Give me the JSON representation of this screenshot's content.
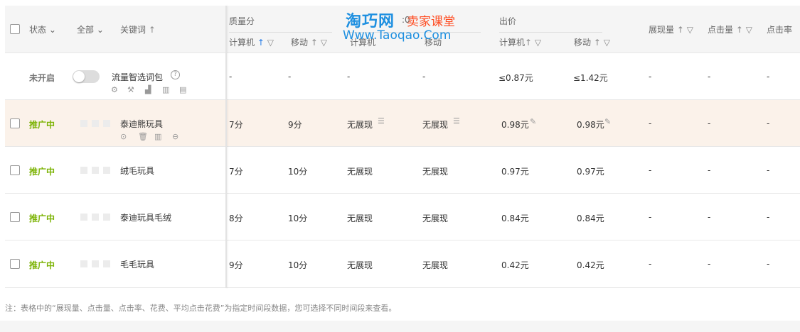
{
  "header": {
    "status": "状态",
    "all": "全部",
    "keyword": "关键词",
    "quality": "质量分",
    "quality_pc": "计算机",
    "quality_mobile": "移动",
    "mid_pc": "计算机",
    "mid_mobile": "移动",
    "mid_partial": ":0",
    "bid": "出价",
    "bid_pc": "计算机",
    "bid_mobile": "移动",
    "impressions": "展现量",
    "clicks": "点击量",
    "ctr": "点击率",
    "sort_up": "↑",
    "filter": "▽",
    "chev": "⌄"
  },
  "watermark": {
    "line1": "淘巧网",
    "line2": "卖家课堂",
    "line3": "Www.Taoqao.Com"
  },
  "smart_row": {
    "status": "未开启",
    "name": "流量智选词包",
    "help": "?",
    "q_pc": "-",
    "q_m": "-",
    "c3": "-",
    "c4": "-",
    "bid_pc": "≤0.87元",
    "bid_m": "≤1.42元",
    "imp": "-",
    "clk": "-",
    "ctr": "-"
  },
  "rows": [
    {
      "status": "推广中",
      "keyword": "泰迪熊玩具",
      "q_pc": "7分",
      "q_m": "9分",
      "c3": "无展现",
      "c4": "无展现",
      "bid_pc": "0.98元",
      "bid_m": "0.98元",
      "imp": "-",
      "clk": "-",
      "ctr": "-"
    },
    {
      "status": "推广中",
      "keyword": "绒毛玩具",
      "q_pc": "7分",
      "q_m": "10分",
      "c3": "无展现",
      "c4": "无展现",
      "bid_pc": "0.97元",
      "bid_m": "0.97元",
      "imp": "-",
      "clk": "-",
      "ctr": "-"
    },
    {
      "status": "推广中",
      "keyword": "泰迪玩具毛绒",
      "q_pc": "8分",
      "q_m": "10分",
      "c3": "无展现",
      "c4": "无展现",
      "bid_pc": "0.84元",
      "bid_m": "0.84元",
      "imp": "-",
      "clk": "-",
      "ctr": "-"
    },
    {
      "status": "推广中",
      "keyword": "毛毛玩具",
      "q_pc": "9分",
      "q_m": "10分",
      "c3": "无展现",
      "c4": "无展现",
      "bid_pc": "0.42元",
      "bid_m": "0.42元",
      "imp": "-",
      "clk": "-",
      "ctr": "-"
    }
  ],
  "footer": "注：表格中的“展现量、点击量、点击率、花费、平均点击花费”为指定时间段数据，您可选择不同时间段来查看。"
}
